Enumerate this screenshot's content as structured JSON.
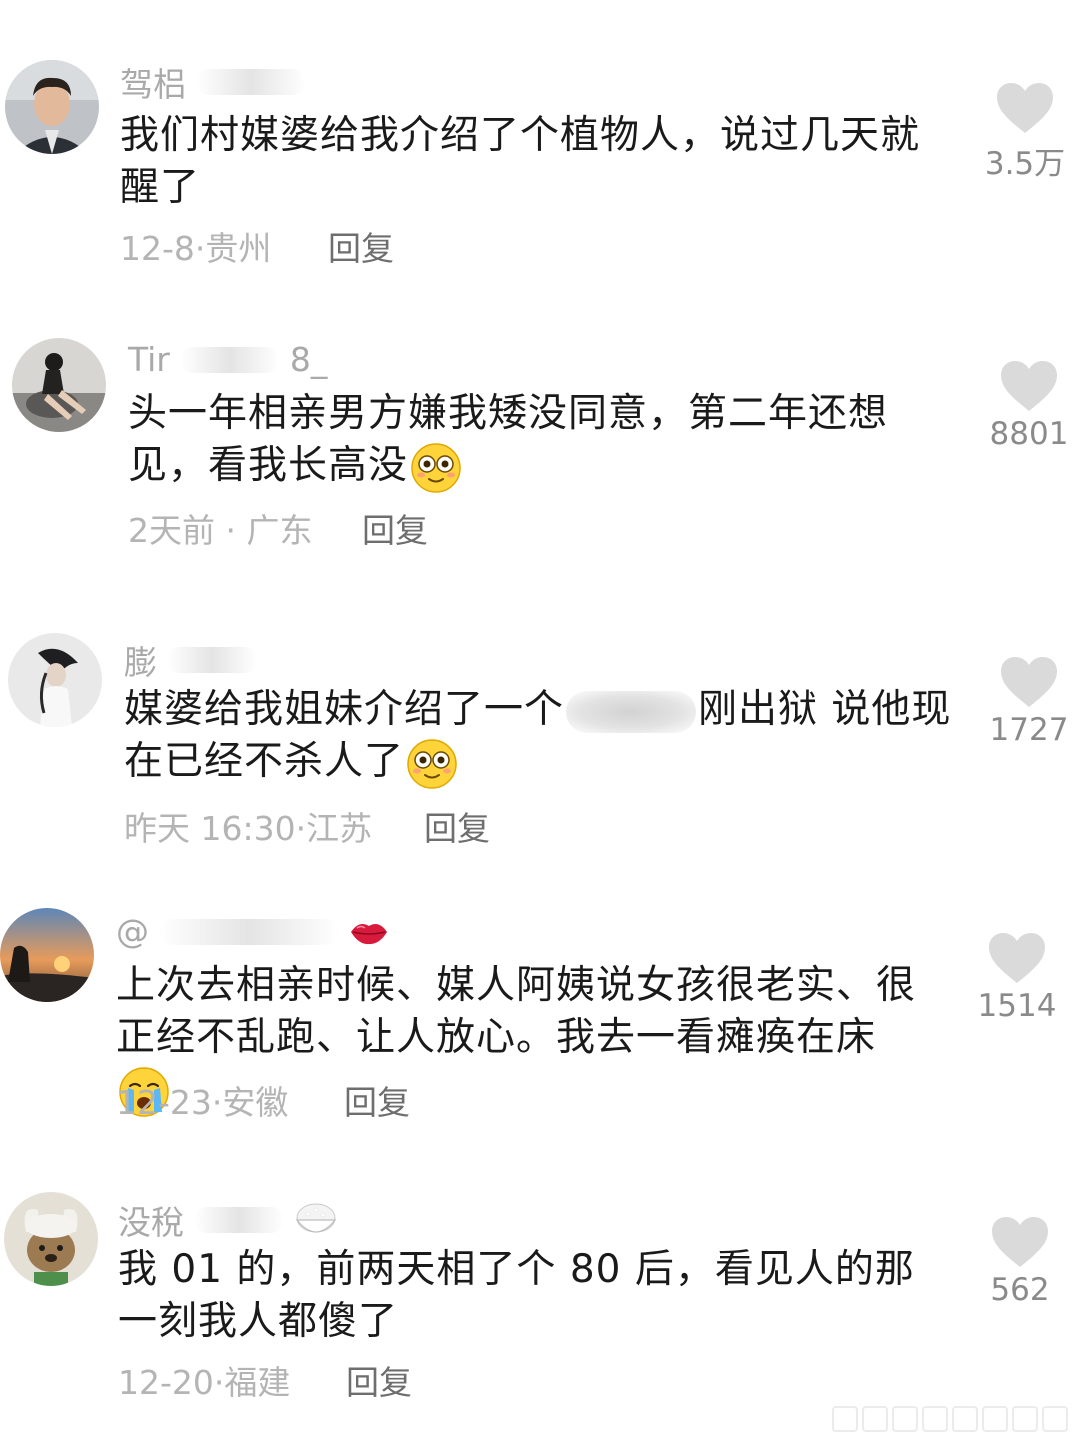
{
  "comments": [
    {
      "username": "驾梠",
      "text": "我们村媒婆给我介绍了个植物人，说过几天就醒了",
      "date": "12-8",
      "location": "贵州",
      "reply": "回复",
      "likes": "3.5万"
    },
    {
      "username": "Tir",
      "username_tail": "8_",
      "text": "头一年相亲男方嫌我矮没同意，第二年还想见，看我长高没",
      "date": "2天前",
      "location": "广东",
      "reply": "回复",
      "likes": "8801"
    },
    {
      "username": "膨",
      "text_a": "媒婆给我姐妹介绍了一个",
      "text_b": "刚出狱  说他现在已经不杀人了",
      "date": "昨天 16:30",
      "location": "江苏",
      "reply": "回复",
      "likes": "1727"
    },
    {
      "username": "@",
      "text": "上次去相亲时候、媒人阿姨说女孩很老实、很正经不乱跑、让人放心。我去一看瘫痪在床",
      "date": "12-23",
      "location": "安徽",
      "reply": "回复",
      "likes": "1514"
    },
    {
      "username": "没稅",
      "text": "我 01 的，前两天相了个 80 后，看见人的那一刻我人都傻了",
      "date": "12-20",
      "location": "福建",
      "reply": "回复",
      "likes": "562"
    }
  ],
  "icons": {
    "heart": "heart-icon",
    "emoji_dizzy": "dizzy-face-emoji",
    "emoji_crying": "crying-face-emoji",
    "emoji_lips": "lips-emoji",
    "emoji_rice": "rice-bowl-emoji"
  },
  "colors": {
    "text": "#1a1a1a",
    "username": "#a9a9a9",
    "meta": "#b4b4b4",
    "reply": "#6e6e6e",
    "heart": "#d9d9d9"
  }
}
